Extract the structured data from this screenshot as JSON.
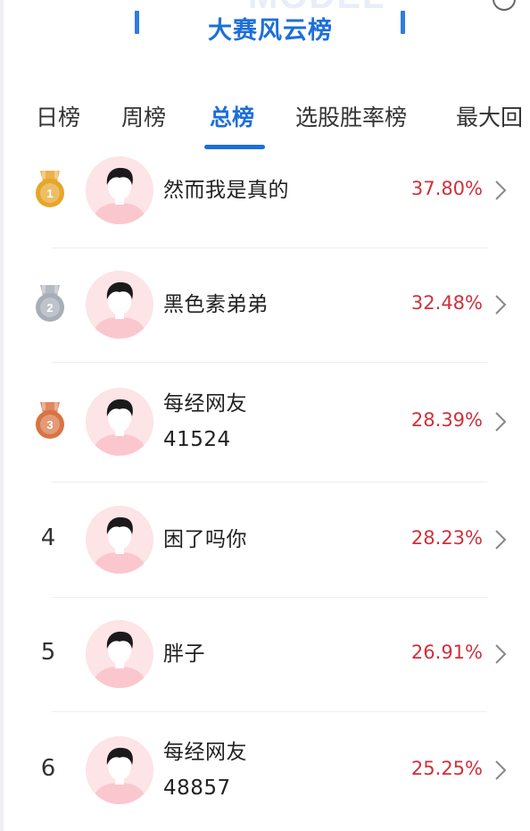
{
  "header": {
    "title": "大赛风云榜",
    "watermark": "MODEL"
  },
  "tabs": [
    {
      "label": "日榜"
    },
    {
      "label": "周榜"
    },
    {
      "label": "总榜"
    },
    {
      "label": "选股胜率榜"
    },
    {
      "label": "最大回"
    }
  ],
  "active_tab": "总榜",
  "medal_colors": {
    "gold": "#e7a52a",
    "silver": "#a7aeb7",
    "bronze": "#d87443"
  },
  "accent_color": "#1d6fd8",
  "return_color": "#d1303a",
  "rankings": [
    {
      "rank": "1",
      "name_line1": "然而我是真的",
      "name_line2": "",
      "return": "37.80%"
    },
    {
      "rank": "2",
      "name_line1": "黑色素弟弟",
      "name_line2": "",
      "return": "32.48%"
    },
    {
      "rank": "3",
      "name_line1": "每经网友",
      "name_line2": "41524",
      "return": "28.39%"
    },
    {
      "rank": "4",
      "name_line1": "困了吗你",
      "name_line2": "",
      "return": "28.23%"
    },
    {
      "rank": "5",
      "name_line1": "胖子",
      "name_line2": "",
      "return": "26.91%"
    },
    {
      "rank": "6",
      "name_line1": "每经网友",
      "name_line2": "48857",
      "return": "25.25%"
    }
  ]
}
